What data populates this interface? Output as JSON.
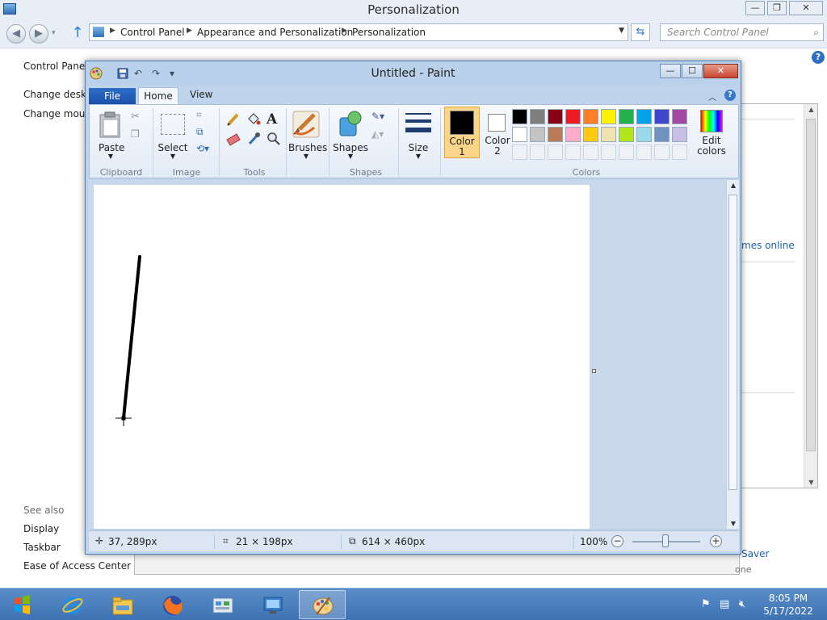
{
  "control_panel": {
    "title": "Personalization",
    "controls": {
      "minimize": "—",
      "restore": "❐",
      "close": "✕"
    },
    "nav": {
      "back": "◀",
      "forward": "▶",
      "recent": "▾",
      "up": "↑"
    },
    "breadcrumb": [
      "Control Panel",
      "Appearance and Personalization",
      "Personalization"
    ],
    "search_placeholder": "Search Control Panel",
    "help": "?",
    "sidebar": {
      "home_link": "Control Panel",
      "links": [
        "Change deskto",
        "Change mous"
      ],
      "see_also_heading": "See also",
      "see_also_links": [
        "Display",
        "Taskbar",
        "Ease of Access Center"
      ]
    },
    "partial_texts": {
      "themes_online": "mes online",
      "screen_saver": "Saver",
      "screen_saver_value": "one"
    }
  },
  "paint": {
    "title": "Untitled - Paint",
    "qat": {
      "undo": "↶",
      "redo": "↷",
      "customize": "▾"
    },
    "window_buttons": {
      "minimize": "—",
      "maximize": "☐",
      "close": "✕"
    },
    "tabs": {
      "file": "File",
      "home": "Home",
      "view": "View"
    },
    "ribbon_help": "?",
    "ribbon_collapse": "︿",
    "ribbon": {
      "clipboard": {
        "group": "Clipboard",
        "paste": "Paste"
      },
      "image": {
        "group": "Image",
        "select": "Select"
      },
      "tools": {
        "group": "Tools",
        "text_tool": "A"
      },
      "brushes": "Brushes",
      "shapes": {
        "group": "Shapes",
        "label": "Shapes"
      },
      "size": "Size",
      "colors": {
        "group": "Colors",
        "color1": "Color\n1",
        "color1_line1": "Color",
        "color1_line2": "1",
        "color2_line1": "Color",
        "color2_line2": "2",
        "edit_line1": "Edit",
        "edit_line2": "colors",
        "color1_value": "#000000",
        "color2_value": "#ffffff",
        "palette_row1": [
          "#000000",
          "#7f7f7f",
          "#880015",
          "#ed1c24",
          "#ff7f27",
          "#fff200",
          "#22b14c",
          "#00a2e8",
          "#3f48cc",
          "#a349a4"
        ],
        "palette_row2": [
          "#ffffff",
          "#c3c3c3",
          "#b97a57",
          "#ffaec9",
          "#ffc90e",
          "#efe4b0",
          "#b5e61d",
          "#99d9ea",
          "#7092be",
          "#c8bfe7"
        ]
      }
    },
    "status": {
      "cursor_pos": "37, 289px",
      "selection_size": "21 × 198px",
      "canvas_size": "614 × 460px",
      "zoom": "100%",
      "zoom_out": "−",
      "zoom_in": "+"
    }
  },
  "taskbar": {
    "time": "8:05 PM",
    "date": "5/17/2022",
    "apps": [
      "internet-explorer",
      "file-explorer",
      "firefox",
      "control-panel",
      "remote-desktop",
      "paint"
    ]
  }
}
